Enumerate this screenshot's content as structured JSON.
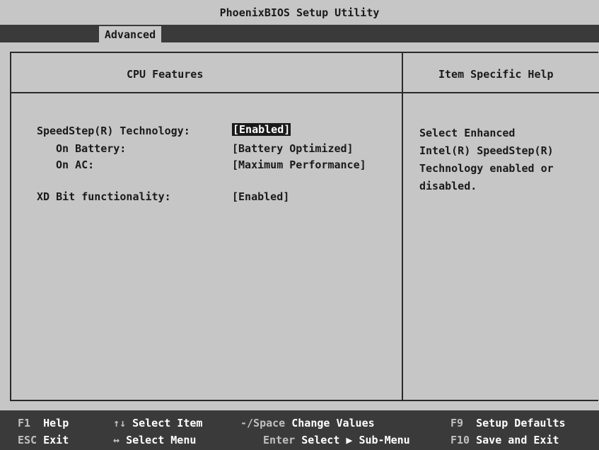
{
  "title": "PhoenixBIOS Setup Utility",
  "menu": {
    "active_tab": "Advanced"
  },
  "panel": {
    "section_title": "CPU Features",
    "help_title": "Item Specific Help",
    "settings": [
      {
        "label": "SpeedStep(R) Technology:",
        "value": "[Enabled]",
        "selected": true
      },
      {
        "label": "On Battery:",
        "value": "[Battery Optimized]",
        "selected": false
      },
      {
        "label": "On AC:",
        "value": "[Maximum Performance]",
        "selected": false
      },
      {
        "label": "XD Bit functionality:",
        "value": "[Enabled]",
        "selected": false
      }
    ],
    "help_lines": [
      "Select Enhanced",
      "Intel(R) SpeedStep(R)",
      "Technology enabled or",
      "disabled."
    ]
  },
  "footer": {
    "row1": [
      {
        "key": "F1",
        "desc": "Help"
      },
      {
        "key": "↑↓",
        "desc": "Select Item"
      },
      {
        "key": "-/Space",
        "desc": "Change Values"
      },
      {
        "key": "F9",
        "desc": "Setup Defaults"
      }
    ],
    "row2": [
      {
        "key": "ESC",
        "desc": "Exit"
      },
      {
        "key": "↔",
        "desc": "Select Menu"
      },
      {
        "key": "Enter",
        "desc": "Select ▶ Sub-Menu"
      },
      {
        "key": "F10",
        "desc": "Save and Exit"
      }
    ]
  },
  "colors": {
    "background": "#c6c6c6",
    "bar": "#3a3a3a",
    "selected_bg": "#1a1a1a"
  }
}
